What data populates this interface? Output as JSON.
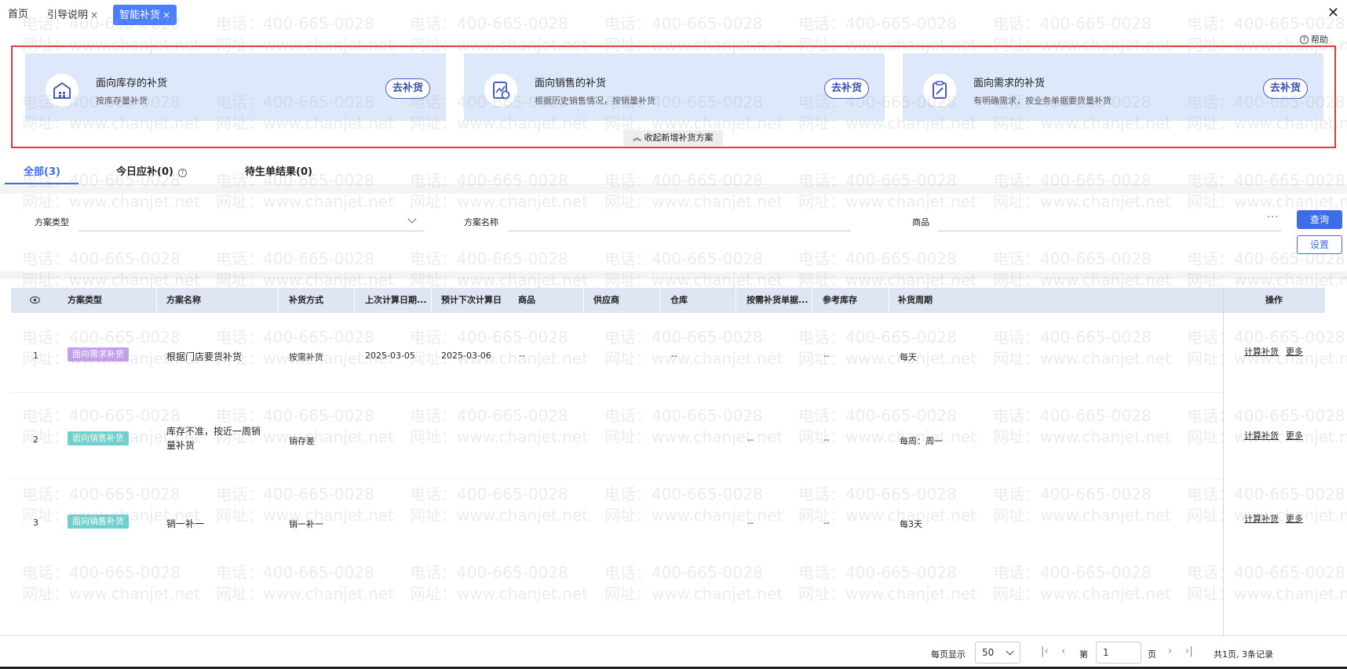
{
  "tabs": [
    {
      "label": "首页",
      "closable": false,
      "active": false
    },
    {
      "label": "引导说明",
      "closable": true,
      "active": false
    },
    {
      "label": "智能补货",
      "closable": true,
      "active": true
    }
  ],
  "tab_close_glyph": "×",
  "window_close_glyph": "✕",
  "help_label": "帮助",
  "cards": [
    {
      "title": "面向库存的补货",
      "desc": "按库存量补货",
      "button": "去补货",
      "icon": "warehouse-icon"
    },
    {
      "title": "面向销售的补货",
      "desc": "根据历史销售情况，按销量补货",
      "button": "去补货",
      "icon": "sales-chart-icon"
    },
    {
      "title": "面向需求的补货",
      "desc": "有明确需求，按业务单据要货量补货",
      "button": "去补货",
      "icon": "clipboard-icon"
    }
  ],
  "collapse_label": "收起新增补货方案",
  "subtabs": [
    {
      "label": "全部(3)",
      "active": true
    },
    {
      "label": "今日应补(0)",
      "active": false,
      "has_help": true
    },
    {
      "label": "待生单结果(0)",
      "active": false
    }
  ],
  "filters": {
    "plan_type_label": "方案类型",
    "plan_name_label": "方案名称",
    "product_label": "商品",
    "more": "···",
    "query_button": "查询",
    "settings_button": "设置"
  },
  "table": {
    "columns": [
      "方案类型",
      "方案名称",
      "补货方式",
      "上次计算日期...",
      "预计下次计算日",
      "商品",
      "供应商",
      "仓库",
      "按需补货单据...",
      "参考库存",
      "补货周期",
      "操作"
    ],
    "rows": [
      {
        "no": "1",
        "type": "面向需求补货",
        "type_kind": "demand",
        "name": "根据门店要货补货",
        "method": "按需补货",
        "last_date": "2025-03-05",
        "next_date": "2025-03-06",
        "product": "--",
        "supplier": "",
        "warehouse": "--",
        "demand_doc": "",
        "ref_stock": "--",
        "cycle": "每天",
        "op1": "计算补货",
        "op2": "更多"
      },
      {
        "no": "2",
        "type": "面向销售补货",
        "type_kind": "sales",
        "name": "库存不准，按近一周销量补货",
        "method": "销存差",
        "last_date": "",
        "next_date": "",
        "product": "",
        "supplier": "",
        "warehouse": "",
        "demand_doc": "--",
        "ref_stock": "--",
        "cycle": "每周：周一",
        "op1": "计算补货",
        "op2": "更多"
      },
      {
        "no": "3",
        "type": "面向销售补货",
        "type_kind": "sales",
        "name": "销一补一",
        "method": "销一补一",
        "last_date": "",
        "next_date": "",
        "product": "",
        "supplier": "",
        "warehouse": "",
        "demand_doc": "--",
        "ref_stock": "--",
        "cycle": "每3天",
        "op1": "计算补货",
        "op2": "更多"
      }
    ]
  },
  "pagination": {
    "per_page_label": "每页显示",
    "per_page_value": "50",
    "page_prefix": "第",
    "page_value": "1",
    "page_suffix": "页",
    "summary": "共1页, 3条记录"
  },
  "watermark": {
    "phone": "电话：400-665-0028",
    "site": "网址：www.chanjet.net"
  },
  "colors": {
    "accent": "#3d6ee8",
    "highlight_border": "#e33b3b",
    "card_bg": "#dde8fb",
    "tag_demand": "#c49ef0",
    "tag_sales": "#6fd1cf"
  }
}
